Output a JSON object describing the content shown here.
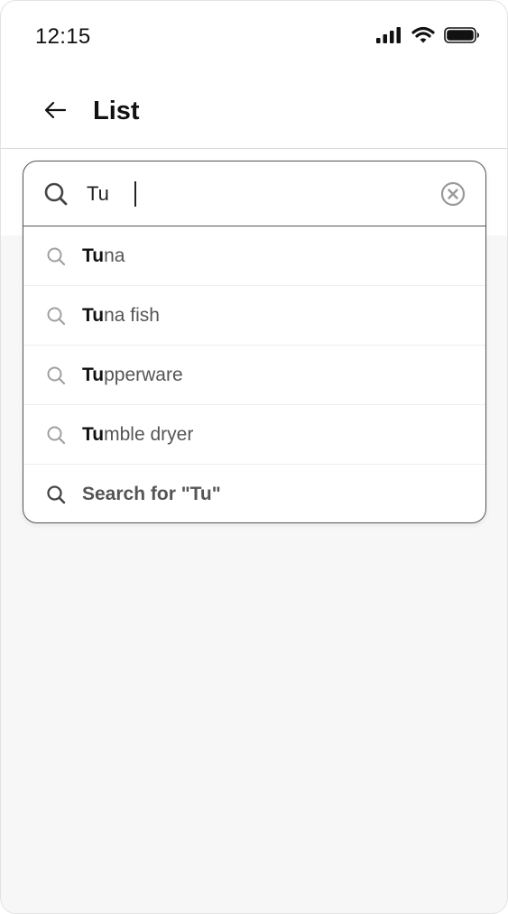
{
  "status_bar": {
    "time": "12:15"
  },
  "header": {
    "title": "List"
  },
  "search": {
    "value": "Tu",
    "placeholder": ""
  },
  "suggestions": [
    {
      "match": "Tu",
      "rest": "na"
    },
    {
      "match": "Tu",
      "rest": "na fish"
    },
    {
      "match": "Tu",
      "rest": "pperware"
    },
    {
      "match": "Tu",
      "rest": "mble dryer"
    }
  ],
  "search_for_label": "Search for \"Tu\"",
  "colors": {
    "border": "#555555",
    "content_bg": "#f7f7f7",
    "icon_gray": "#a0a0a0"
  },
  "icons": [
    "signal-icon",
    "wifi-icon",
    "battery-icon",
    "back-arrow-icon",
    "search-icon",
    "clear-icon"
  ]
}
